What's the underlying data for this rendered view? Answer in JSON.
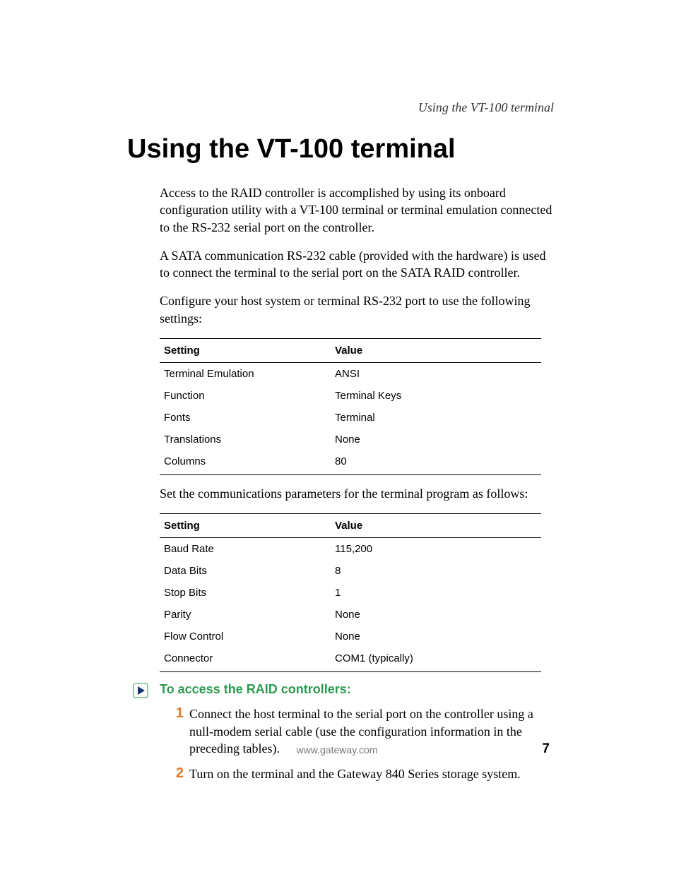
{
  "running_head": "Using the VT-100 terminal",
  "title": "Using the VT-100 terminal",
  "paragraphs": {
    "p1": "Access to the RAID controller is accomplished by using its onboard configuration utility with a VT-100 terminal or terminal emulation connected to the RS-232 serial port on the controller.",
    "p2": "A SATA communication RS-232 cable (provided with the hardware) is used to connect the terminal to the serial port on the SATA RAID controller.",
    "p3": "Configure your host system or terminal RS-232 port to use the following settings:",
    "p4": "Set the communications parameters for the terminal program as follows:"
  },
  "table1": {
    "headers": {
      "c1": "Setting",
      "c2": "Value"
    },
    "rows": [
      {
        "c1": "Terminal Emulation",
        "c2": "ANSI"
      },
      {
        "c1": "Function",
        "c2": "Terminal Keys"
      },
      {
        "c1": "Fonts",
        "c2": "Terminal"
      },
      {
        "c1": "Translations",
        "c2": "None"
      },
      {
        "c1": "Columns",
        "c2": "80"
      }
    ]
  },
  "table2": {
    "headers": {
      "c1": "Setting",
      "c2": "Value"
    },
    "rows": [
      {
        "c1": "Baud Rate",
        "c2": "115,200"
      },
      {
        "c1": "Data Bits",
        "c2": "8"
      },
      {
        "c1": "Stop Bits",
        "c2": "1"
      },
      {
        "c1": "Parity",
        "c2": "None"
      },
      {
        "c1": "Flow Control",
        "c2": "None"
      },
      {
        "c1": "Connector",
        "c2": "COM1 (typically)"
      }
    ]
  },
  "procedure": {
    "title": "To access the RAID controllers:",
    "steps": [
      {
        "n": "1",
        "text": "Connect the host terminal to the serial port on the controller using a null-modem serial cable (use the configuration information in the preceding tables)."
      },
      {
        "n": "2",
        "text": "Turn on the terminal and the Gateway 840 Series storage system."
      }
    ]
  },
  "footer_url": "www.gateway.com",
  "page_number": "7"
}
